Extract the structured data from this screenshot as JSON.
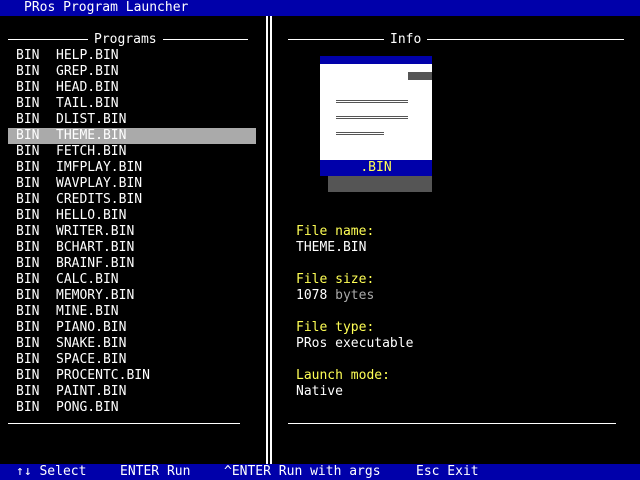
{
  "app": {
    "title": "PRos Program Launcher"
  },
  "programs_panel": {
    "heading": "Programs",
    "selected_index": 5,
    "items": [
      {
        "ext": "BIN",
        "name": "HELP.BIN"
      },
      {
        "ext": "BIN",
        "name": "GREP.BIN"
      },
      {
        "ext": "BIN",
        "name": "HEAD.BIN"
      },
      {
        "ext": "BIN",
        "name": "TAIL.BIN"
      },
      {
        "ext": "BIN",
        "name": "DLIST.BIN"
      },
      {
        "ext": "BIN",
        "name": "THEME.BIN"
      },
      {
        "ext": "BIN",
        "name": "FETCH.BIN"
      },
      {
        "ext": "BIN",
        "name": "IMFPLAY.BIN"
      },
      {
        "ext": "BIN",
        "name": "WAVPLAY.BIN"
      },
      {
        "ext": "BIN",
        "name": "CREDITS.BIN"
      },
      {
        "ext": "BIN",
        "name": "HELLO.BIN"
      },
      {
        "ext": "BIN",
        "name": "WRITER.BIN"
      },
      {
        "ext": "BIN",
        "name": "BCHART.BIN"
      },
      {
        "ext": "BIN",
        "name": "BRAINF.BIN"
      },
      {
        "ext": "BIN",
        "name": "CALC.BIN"
      },
      {
        "ext": "BIN",
        "name": "MEMORY.BIN"
      },
      {
        "ext": "BIN",
        "name": "MINE.BIN"
      },
      {
        "ext": "BIN",
        "name": "PIANO.BIN"
      },
      {
        "ext": "BIN",
        "name": "SNAKE.BIN"
      },
      {
        "ext": "BIN",
        "name": "SPACE.BIN"
      },
      {
        "ext": "BIN",
        "name": "PROCENTC.BIN"
      },
      {
        "ext": "BIN",
        "name": "PAINT.BIN"
      },
      {
        "ext": "BIN",
        "name": "PONG.BIN"
      }
    ]
  },
  "info_panel": {
    "heading": "Info",
    "icon": {
      "name": "document-icon",
      "label": ".BIN"
    },
    "file_name_label": "File name:",
    "file_name": "THEME.BIN",
    "file_size_label": "File size:",
    "file_size": "1078",
    "file_size_unit": "bytes",
    "file_type_label": "File type:",
    "file_type": "PRos executable",
    "launch_mode_label": "Launch mode:",
    "launch_mode": "Native"
  },
  "status_bar": {
    "select_hint": "↑↓ Select",
    "run_hint": "ENTER Run",
    "run_args_hint": "^ENTER Run with args",
    "exit_hint": "Esc Exit"
  },
  "colors": {
    "bar_background": "#0000aa",
    "selection_background": "#aaaaaa",
    "label_yellow": "#ffff55",
    "shadow_gray": "#555555"
  }
}
